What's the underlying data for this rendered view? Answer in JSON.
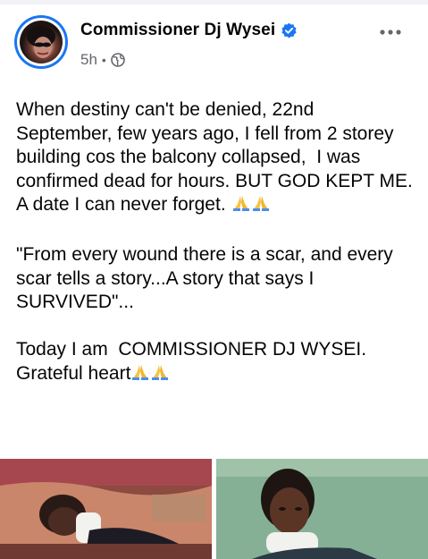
{
  "post": {
    "author": "Commissioner Dj Wysei",
    "time": "5h",
    "separator": "•",
    "audience_icon": "globe-icon",
    "verified_icon": "verified-badge-icon",
    "more_icon": "more-options-icon",
    "paragraphs": [
      "When destiny can't be denied, 22nd September, few years ago, I fell from 2 storey building cos the balcony collapsed,  I was confirmed dead for hours. BUT GOD KEPT ME. A date I can never forget. ",
      "\"From every wound there is a scar, and every scar tells a story...A story that says I SURVIVED\"...",
      "Today I am  COMMISSIONER DJ WYSEI. Grateful heart"
    ],
    "emoji": "praying-hands-emoji"
  },
  "photos": [
    {
      "description_icon": "photo-hospital-bed"
    },
    {
      "description_icon": "photo-neck-brace"
    }
  ],
  "colors": {
    "accent": "#1877f2",
    "text": "#050505",
    "secondary_text": "#65676b",
    "background": "#ffffff",
    "divider": "#f0f2f5"
  }
}
